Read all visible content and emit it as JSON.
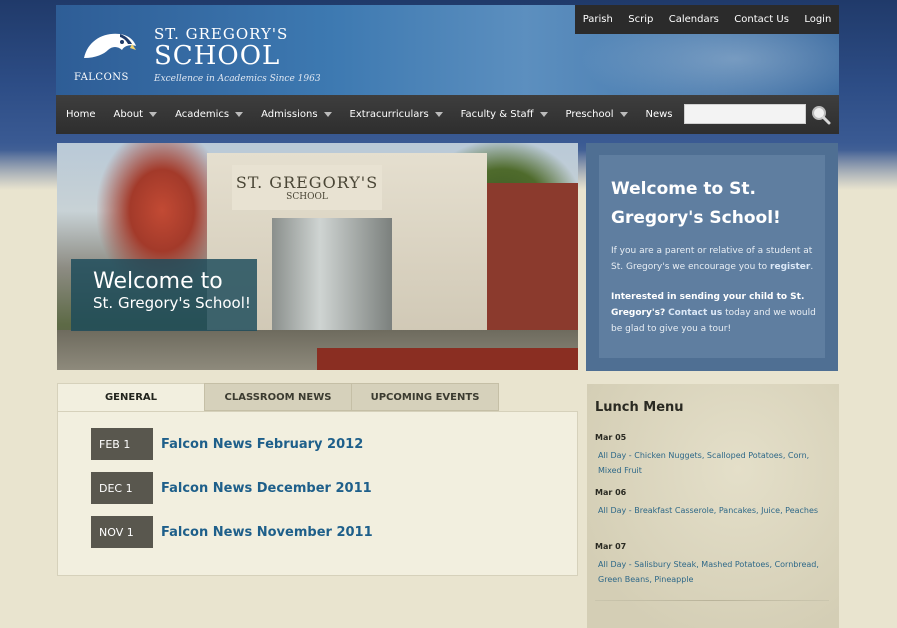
{
  "header": {
    "falcons": "FALCONS",
    "school_st": "ST. GREGORY'S",
    "school_name": "SCHOOL",
    "tagline": "Excellence in Academics Since 1963"
  },
  "util_nav": [
    "Parish",
    "Scrip",
    "Calendars",
    "Contact Us",
    "Login"
  ],
  "main_nav": [
    {
      "label": "Home",
      "dropdown": false
    },
    {
      "label": "About",
      "dropdown": true
    },
    {
      "label": "Academics",
      "dropdown": true
    },
    {
      "label": "Admissions",
      "dropdown": true
    },
    {
      "label": "Extracurriculars",
      "dropdown": true
    },
    {
      "label": "Faculty & Staff",
      "dropdown": true
    },
    {
      "label": "Preschool",
      "dropdown": true
    },
    {
      "label": "News",
      "dropdown": false
    }
  ],
  "search": {
    "placeholder": ""
  },
  "hero": {
    "sign_line1": "ST. GREGORY'S",
    "sign_line2": "SCHOOL",
    "caption_line1": "Welcome to",
    "caption_line2": "St. Gregory's School!"
  },
  "welcome": {
    "title": "Welcome to St. Gregory's School!",
    "p1_text": "If you are a parent or relative of a student at St. Gregory's we encourage you to",
    "p1_link": "register",
    "p1_end": ".",
    "p2_bold": "Interested in sending your child to St. Gregory's?",
    "p2_link": "Contact us",
    "p2_text": "today and we would be glad to give you a tour!"
  },
  "tabs": [
    {
      "label": "GENERAL",
      "active": true
    },
    {
      "label": "CLASSROOM NEWS",
      "active": false
    },
    {
      "label": "UPCOMING EVENTS",
      "active": false
    }
  ],
  "news": [
    {
      "date": "FEB 1",
      "title": "Falcon News February 2012"
    },
    {
      "date": "DEC 1",
      "title": "Falcon News December 2011"
    },
    {
      "date": "NOV 1",
      "title": "Falcon News November 2011"
    }
  ],
  "lunch": {
    "title": "Lunch Menu",
    "days": [
      {
        "date": "Mar 05",
        "items": "All Day - Chicken Nuggets, Scalloped Potatoes, Corn, Mixed Fruit"
      },
      {
        "date": "Mar 06",
        "items": "All Day - Breakfast Casserole, Pancakes, Juice, Peaches"
      },
      {
        "date": "Mar 07",
        "items": "All Day - Salisbury Steak, Mashed Potatoes, Cornbread, Green Beans, Pineapple"
      }
    ]
  },
  "colors": {
    "nav_bg": "#333333",
    "link_blue": "#1e5f8a",
    "welcome_bg": "#4f6f93",
    "caption_bg": "#1b4a5a",
    "date_badge": "#59574e"
  },
  "icons": {
    "search": "magnifier-icon",
    "logo": "falcon-head-icon",
    "caret": "caret-down-icon"
  }
}
